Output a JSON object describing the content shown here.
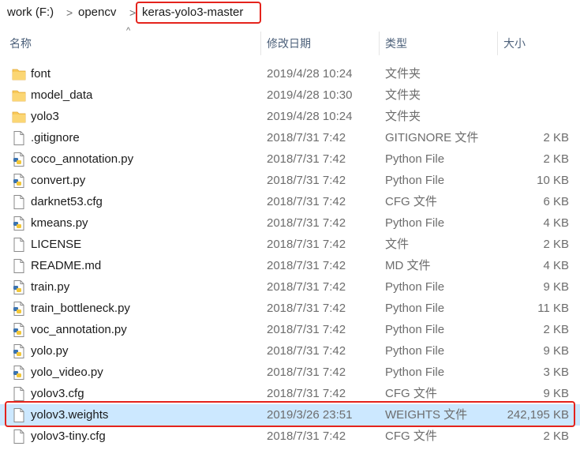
{
  "breadcrumb": {
    "items": [
      "work (F:)",
      "opencv",
      "keras-yolo3-master"
    ],
    "separator": ">",
    "highlight_color": "#e4231c"
  },
  "columns": {
    "name": "名称",
    "date": "修改日期",
    "type": "类型",
    "size": "大小",
    "sort_indicator": "^"
  },
  "files": [
    {
      "name": "font",
      "date": "2019/4/28 10:24",
      "type": "文件夹",
      "size": "",
      "icon": "folder-icon"
    },
    {
      "name": "model_data",
      "date": "2019/4/28 10:30",
      "type": "文件夹",
      "size": "",
      "icon": "folder-icon"
    },
    {
      "name": "yolo3",
      "date": "2019/4/28 10:24",
      "type": "文件夹",
      "size": "",
      "icon": "folder-icon"
    },
    {
      "name": ".gitignore",
      "date": "2018/7/31 7:42",
      "type": "GITIGNORE 文件",
      "size": "2 KB",
      "icon": "file-icon"
    },
    {
      "name": "coco_annotation.py",
      "date": "2018/7/31 7:42",
      "type": "Python File",
      "size": "2 KB",
      "icon": "python-file-icon"
    },
    {
      "name": "convert.py",
      "date": "2018/7/31 7:42",
      "type": "Python File",
      "size": "10 KB",
      "icon": "python-file-icon"
    },
    {
      "name": "darknet53.cfg",
      "date": "2018/7/31 7:42",
      "type": "CFG 文件",
      "size": "6 KB",
      "icon": "file-icon"
    },
    {
      "name": "kmeans.py",
      "date": "2018/7/31 7:42",
      "type": "Python File",
      "size": "4 KB",
      "icon": "python-file-icon"
    },
    {
      "name": "LICENSE",
      "date": "2018/7/31 7:42",
      "type": "文件",
      "size": "2 KB",
      "icon": "file-icon"
    },
    {
      "name": "README.md",
      "date": "2018/7/31 7:42",
      "type": "MD 文件",
      "size": "4 KB",
      "icon": "file-icon"
    },
    {
      "name": "train.py",
      "date": "2018/7/31 7:42",
      "type": "Python File",
      "size": "9 KB",
      "icon": "python-file-icon"
    },
    {
      "name": "train_bottleneck.py",
      "date": "2018/7/31 7:42",
      "type": "Python File",
      "size": "11 KB",
      "icon": "python-file-icon"
    },
    {
      "name": "voc_annotation.py",
      "date": "2018/7/31 7:42",
      "type": "Python File",
      "size": "2 KB",
      "icon": "python-file-icon"
    },
    {
      "name": "yolo.py",
      "date": "2018/7/31 7:42",
      "type": "Python File",
      "size": "9 KB",
      "icon": "python-file-icon"
    },
    {
      "name": "yolo_video.py",
      "date": "2018/7/31 7:42",
      "type": "Python File",
      "size": "3 KB",
      "icon": "python-file-icon"
    },
    {
      "name": "yolov3.cfg",
      "date": "2018/7/31 7:42",
      "type": "CFG 文件",
      "size": "9 KB",
      "icon": "file-icon"
    },
    {
      "name": "yolov3.weights",
      "date": "2019/3/26 23:51",
      "type": "WEIGHTS 文件",
      "size": "242,195 KB",
      "icon": "file-icon",
      "selected": true
    },
    {
      "name": "yolov3-tiny.cfg",
      "date": "2018/7/31 7:42",
      "type": "CFG 文件",
      "size": "2 KB",
      "icon": "file-icon"
    }
  ],
  "colors": {
    "selection": "#cce8ff",
    "highlight": "#e4231c",
    "folder": "#f8c95a"
  }
}
